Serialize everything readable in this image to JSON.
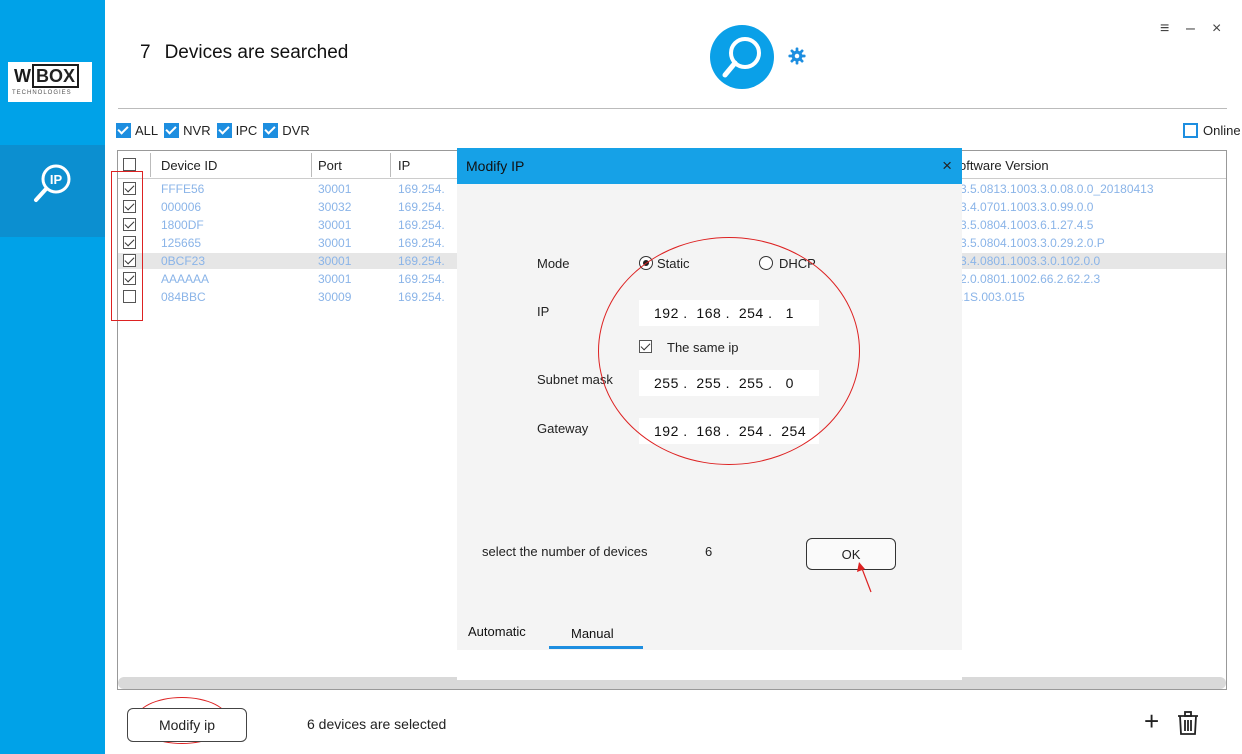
{
  "app": {
    "logo": {
      "w": "W",
      "box": "BOX",
      "sub": "TECHNOLOGIES"
    },
    "title_count": "7",
    "title_text": "Devices are searched",
    "window_controls": {
      "menu": "≡",
      "minimize": "–",
      "close": "×"
    }
  },
  "filters": {
    "items": [
      {
        "label": "ALL",
        "checked": true
      },
      {
        "label": "NVR",
        "checked": true
      },
      {
        "label": "IPC",
        "checked": true
      },
      {
        "label": "DVR",
        "checked": true
      }
    ],
    "online_label": "Online"
  },
  "table": {
    "headers": {
      "device_id": "Device ID",
      "port": "Port",
      "ip": "IP",
      "software": "oftware Version"
    },
    "rows": [
      {
        "checked": true,
        "device_id": "FFFE56",
        "port": "30001",
        "ip": "169.254.",
        "software": "3.5.0813.1003.3.0.08.0.0_20180413",
        "highlight": false
      },
      {
        "checked": true,
        "device_id": "000006",
        "port": "30032",
        "ip": "169.254.",
        "software": "3.4.0701.1003.3.0.99.0.0",
        "highlight": false
      },
      {
        "checked": true,
        "device_id": "1800DF",
        "port": "30001",
        "ip": "169.254.",
        "software": "3.5.0804.1003.6.1.27.4.5",
        "highlight": false
      },
      {
        "checked": true,
        "device_id": "125665",
        "port": "30001",
        "ip": "169.254.",
        "software": "3.5.0804.1003.3.0.29.2.0.P",
        "highlight": false
      },
      {
        "checked": true,
        "device_id": "0BCF23",
        "port": "30001",
        "ip": "169.254.",
        "software": "3.4.0801.1003.3.0.102.0.0",
        "highlight": true
      },
      {
        "checked": true,
        "device_id": "AAAAAA",
        "port": "30001",
        "ip": "169.254.",
        "software": "2.0.0801.1002.66.2.62.2.3",
        "highlight": false
      },
      {
        "checked": false,
        "device_id": "084BBC",
        "port": "30009",
        "ip": "169.254.",
        "software": ".1S.003.015",
        "highlight": false
      }
    ]
  },
  "modal": {
    "title": "Modify IP",
    "close": "×",
    "mode_label": "Mode",
    "static_label": "Static",
    "dhcp_label": "DHCP",
    "ip_label": "IP",
    "ip_value": "192 .  168 .  254 .   1",
    "same_ip_label": "The same ip",
    "subnet_label": "Subnet mask",
    "subnet_value": "255 .  255 .  255 .   0",
    "gateway_label": "Gateway",
    "gateway_value": "192 .  168 .  254 .  254",
    "count_label": "select the number of devices",
    "count_value": "6",
    "ok_label": "OK",
    "tab_automatic": "Automatic",
    "tab_manual": "Manual"
  },
  "footer": {
    "modify_button": "Modify ip",
    "selected_text": "6 devices are selected",
    "add_icon": "+"
  },
  "colors": {
    "accent": "#00a2e8",
    "modal_header": "#16a1e7",
    "annotation": "#dd2222"
  }
}
